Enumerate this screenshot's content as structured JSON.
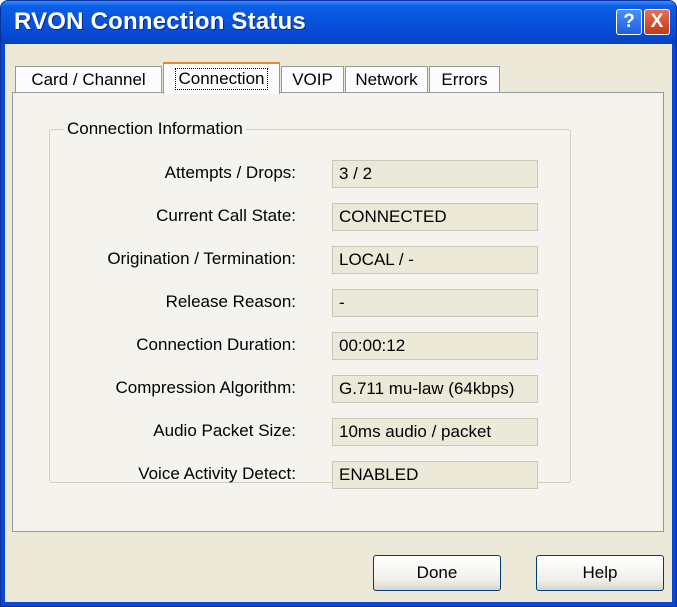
{
  "window": {
    "title": "RVON Connection Status",
    "help_glyph": "?",
    "close_glyph": "X"
  },
  "tabs": [
    {
      "label": "Card / Channel",
      "active": false
    },
    {
      "label": "Connection",
      "active": true
    },
    {
      "label": "VOIP",
      "active": false
    },
    {
      "label": "Network",
      "active": false
    },
    {
      "label": "Errors",
      "active": false
    }
  ],
  "group": {
    "title": "Connection Information",
    "rows": [
      {
        "label": "Attempts / Drops:",
        "value": "3 / 2"
      },
      {
        "label": "Current Call State:",
        "value": "CONNECTED"
      },
      {
        "label": "Origination / Termination:",
        "value": "LOCAL / -"
      },
      {
        "label": "Release Reason:",
        "value": "-"
      },
      {
        "label": "Connection Duration:",
        "value": "00:00:12"
      },
      {
        "label": "Compression Algorithm:",
        "value": "G.711 mu-law (64kbps)"
      },
      {
        "label": "Audio Packet Size:",
        "value": "10ms audio / packet"
      },
      {
        "label": "Voice Activity Detect:",
        "value": "ENABLED"
      }
    ]
  },
  "buttons": {
    "done_label": "Done",
    "help_label": "Help"
  },
  "colors": {
    "titlebar": "#0a52dc",
    "dialog_bg": "#ece9d8",
    "active_tab_accent": "#e68b2c",
    "close_button": "#c2391b"
  }
}
